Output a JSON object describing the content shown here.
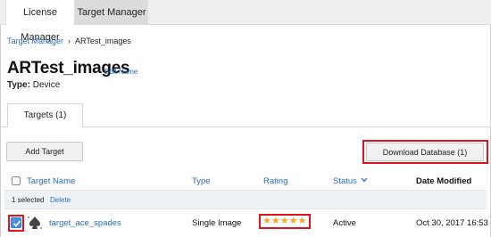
{
  "topnav": {
    "tabs": [
      {
        "label": "License Manager"
      },
      {
        "label": "Target Manager"
      }
    ]
  },
  "breadcrumb": {
    "parent": "Target Manager",
    "separator": "›",
    "current": "ARTest_images"
  },
  "database": {
    "name": "ARTest_images",
    "edit_label": "Edit Name",
    "type_label": "Type:",
    "type_value": "Device"
  },
  "tabs": [
    {
      "label": "Targets (1)"
    }
  ],
  "toolbar": {
    "add_label": "Add Target",
    "download_label": "Download Database (1)"
  },
  "table": {
    "headers": {
      "name": "Target Name",
      "type": "Type",
      "rating": "Rating",
      "status": "Status",
      "status_sort_icon": "chevron-down-icon",
      "date": "Date Modified"
    },
    "selection": {
      "count_text": "1 selected",
      "delete_label": "Delete"
    },
    "rows": [
      {
        "checked": true,
        "name": "target_ace_spades",
        "type": "Single Image",
        "rating": 5,
        "rating_stars": "★★★★★",
        "status": "Active",
        "date": "Oct 30, 2017 16:53"
      }
    ]
  },
  "colors": {
    "link": "#2f6db5",
    "highlight": "#e0141d",
    "star": "#f5a623",
    "checkbox": "#4a90e2"
  }
}
